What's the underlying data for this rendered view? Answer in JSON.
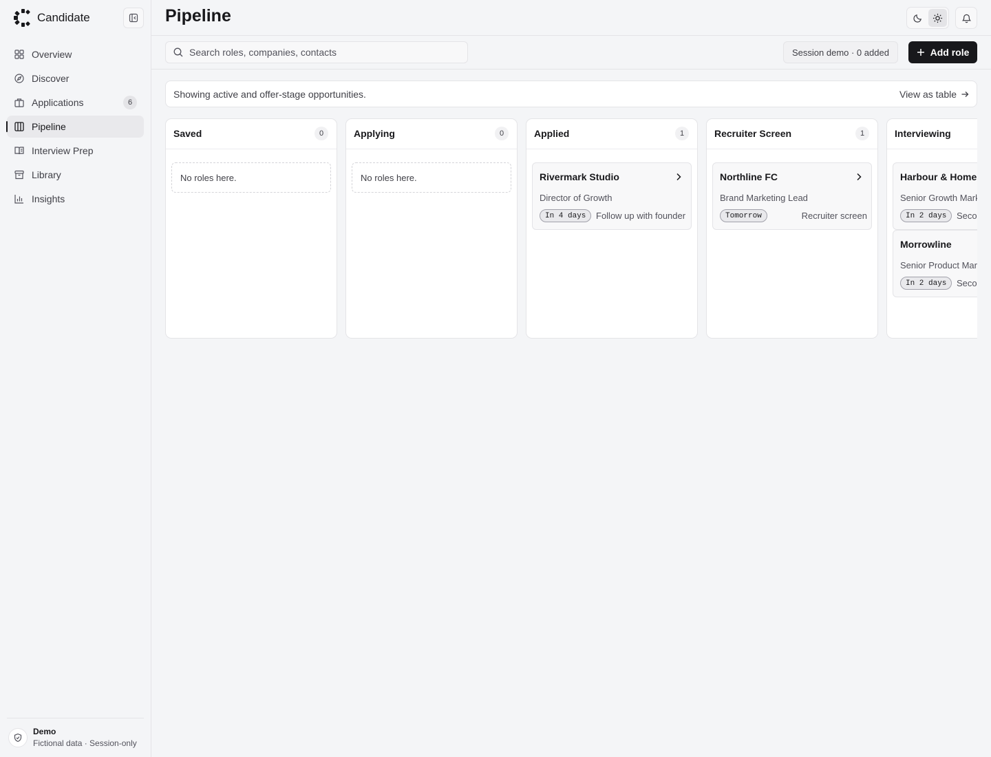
{
  "app": {
    "name": "Candidate"
  },
  "sidebar": {
    "items": [
      {
        "label": "Overview",
        "icon": "grid-icon"
      },
      {
        "label": "Discover",
        "icon": "compass-icon"
      },
      {
        "label": "Applications",
        "icon": "building-icon",
        "badge": "6"
      },
      {
        "label": "Pipeline",
        "icon": "columns-icon",
        "active": true
      },
      {
        "label": "Interview Prep",
        "icon": "book-icon"
      },
      {
        "label": "Library",
        "icon": "archive-icon"
      },
      {
        "label": "Insights",
        "icon": "bar-chart-icon"
      }
    ],
    "footer": {
      "title": "Demo",
      "subtitle": "Fictional data · Session-only"
    }
  },
  "header": {
    "title": "Pipeline"
  },
  "toolbar": {
    "search_placeholder": "Search roles, companies, contacts",
    "session_label": "Session demo · 0 added",
    "add_label": "Add role"
  },
  "banner": {
    "text": "Showing active and offer-stage opportunities.",
    "link": "View as table"
  },
  "board": {
    "columns": [
      {
        "title": "Saved",
        "count": "0",
        "empty": "No roles here.",
        "cards": []
      },
      {
        "title": "Applying",
        "count": "0",
        "empty": "No roles here.",
        "cards": []
      },
      {
        "title": "Applied",
        "count": "1",
        "cards": [
          {
            "company": "Rivermark Studio",
            "role": "Director of Growth",
            "tag": "In 4 days",
            "note": "Follow up with founder"
          }
        ]
      },
      {
        "title": "Recruiter Screen",
        "count": "1",
        "cards": [
          {
            "company": "Northline FC",
            "role": "Brand Marketing Lead",
            "tag": "Tomorrow",
            "note": "Recruiter screen"
          }
        ]
      },
      {
        "title": "Interviewing",
        "cards": [
          {
            "company": "Harbour & Home",
            "role": "Senior Growth Marketing Manager",
            "tag": "In 2 days",
            "note": "Second interview"
          },
          {
            "company": "Morrowline",
            "role": "Senior Product Marketing Manager",
            "tag": "In 2 days",
            "note": "Second interview"
          }
        ]
      }
    ]
  },
  "colors": {
    "accent": "#18181b",
    "background": "#f4f5f7",
    "surface": "#ffffff",
    "border": "#e4e4e7"
  }
}
